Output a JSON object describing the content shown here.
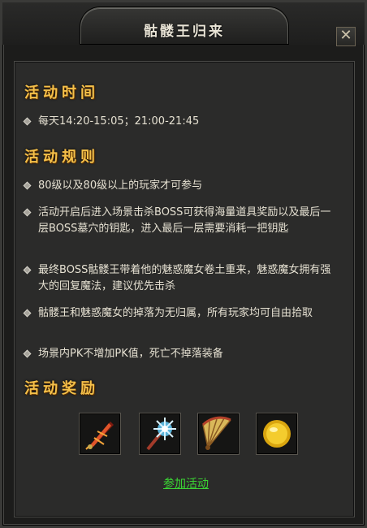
{
  "window": {
    "title": "骷髅王归来",
    "close_label": "✕"
  },
  "sections": {
    "time": {
      "title": "活动时间",
      "items": [
        "每天14:20-15:05；21:00-21:45"
      ]
    },
    "rules": {
      "title": "活动规则",
      "items": [
        "80级以及80级以上的玩家才可参与",
        "活动开启后进入场景击杀BOSS可获得海量道具奖励以及最后一层BOSS墓穴的钥匙，进入最后一层需要消耗一把钥匙",
        "最终BOSS骷髅王带着他的魅惑魔女卷土重来，魅惑魔女拥有强大的回复魔法，建议优先击杀",
        "骷髅王和魅惑魔女的掉落为无归属，所有玩家均可自由拾取",
        "场景内PK不增加PK值，死亡不掉落装备"
      ]
    },
    "rewards": {
      "title": "活动奖励",
      "items": [
        {
          "icon": "flame-sword-icon"
        },
        {
          "icon": "crystal-mace-icon"
        },
        {
          "icon": "golden-fan-icon"
        },
        {
          "icon": "gold-coin-icon"
        }
      ]
    }
  },
  "join_link": "参加活动",
  "colors": {
    "section_title": "#f4c04a",
    "text": "#e6e1d2",
    "link": "#3bd534"
  }
}
